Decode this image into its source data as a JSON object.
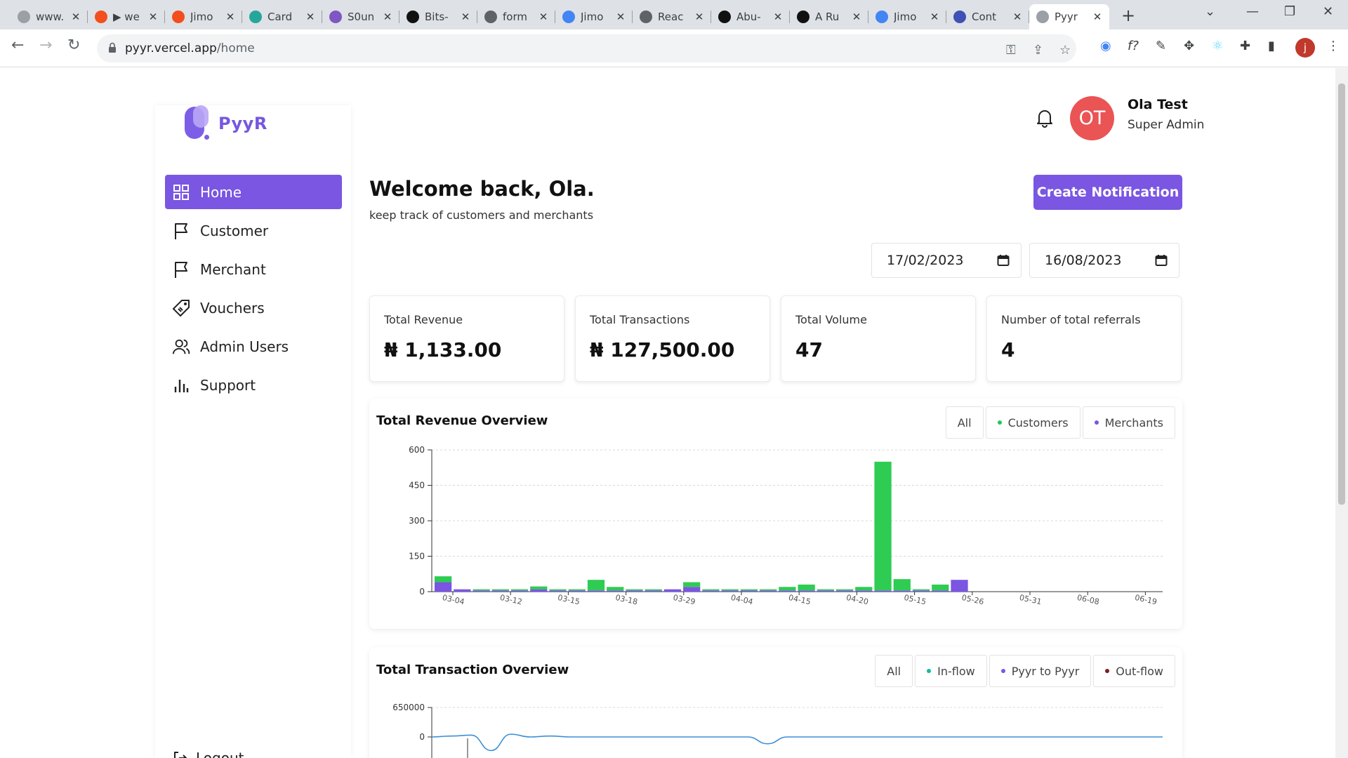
{
  "browser": {
    "tabs": [
      {
        "title": "www.",
        "color": "#9aa0a6"
      },
      {
        "title": "▶ we",
        "color": "#f24e1e"
      },
      {
        "title": "Jimo",
        "color": "#f24e1e"
      },
      {
        "title": "Card",
        "color": "#26a69a"
      },
      {
        "title": "S0un",
        "color": "#7e57c2"
      },
      {
        "title": "Bits-",
        "color": "#111111"
      },
      {
        "title": "form",
        "color": "#5f6368"
      },
      {
        "title": "Jimo",
        "color": "#4285f4"
      },
      {
        "title": "Reac",
        "color": "#5f6368"
      },
      {
        "title": "Abu-",
        "color": "#111111"
      },
      {
        "title": "A Ru",
        "color": "#111111"
      },
      {
        "title": "Jimo",
        "color": "#4285f4"
      },
      {
        "title": "Cont",
        "color": "#3f51b5"
      },
      {
        "title": "Pyyr",
        "color": "#9aa0a6"
      }
    ],
    "url_host": "pyyr.vercel.app",
    "url_path": "/home",
    "profile_initial": "j"
  },
  "brand": {
    "name": "PyyR",
    "accent": "#7a56e2"
  },
  "sidebar": {
    "items": [
      {
        "label": "Home",
        "icon": "grid-icon"
      },
      {
        "label": "Customer",
        "icon": "flag-icon"
      },
      {
        "label": "Merchant",
        "icon": "flag-icon"
      },
      {
        "label": "Vouchers",
        "icon": "tag-icon"
      },
      {
        "label": "Admin Users",
        "icon": "users-icon"
      },
      {
        "label": "Support",
        "icon": "bar-chart-icon"
      }
    ],
    "logout": "Logout"
  },
  "header": {
    "avatar_initials": "OT",
    "user_name": "Ola Test",
    "user_role": "Super Admin"
  },
  "main": {
    "welcome": "Welcome back, Ola.",
    "subtitle": "keep track of customers and merchants",
    "create_button": "Create Notification",
    "date_from": "17/02/2023",
    "date_to": "16/08/2023"
  },
  "stats": [
    {
      "label": "Total Revenue",
      "value": "₦ 1,133.00"
    },
    {
      "label": "Total Transactions",
      "value": "₦ 127,500.00"
    },
    {
      "label": "Total Volume",
      "value": "47"
    },
    {
      "label": "Number of total referrals",
      "value": "4"
    }
  ],
  "revenue_panel": {
    "title": "Total Revenue Overview",
    "filters": [
      {
        "label": "All",
        "dot": ""
      },
      {
        "label": "Customers",
        "dot": "#22c55e"
      },
      {
        "label": "Merchants",
        "dot": "#7a56e2"
      }
    ]
  },
  "transaction_panel": {
    "title": "Total Transaction Overview",
    "filters": [
      {
        "label": "All",
        "dot": ""
      },
      {
        "label": "In-flow",
        "dot": "#14b8a6"
      },
      {
        "label": "Pyyr to Pyyr",
        "dot": "#7a56e2"
      },
      {
        "label": "Out-flow",
        "dot": "#7f1d1d"
      }
    ]
  },
  "chart_data": [
    {
      "type": "bar",
      "stacked": true,
      "title": "Total Revenue Overview",
      "ylim": [
        0,
        600
      ],
      "yticks": [
        0,
        150,
        300,
        450,
        600
      ],
      "xtick_labels": [
        "03-04",
        "03-12",
        "03-15",
        "03-18",
        "03-29",
        "04-04",
        "04-15",
        "04-20",
        "05-15",
        "05-26",
        "05-31",
        "06-08",
        "06-19"
      ],
      "grid": true,
      "series": [
        {
          "color": "#7a56e2",
          "values": [
            40,
            10,
            5,
            5,
            5,
            10,
            5,
            5,
            5,
            5,
            5,
            5,
            10,
            20,
            5,
            5,
            5,
            5,
            5,
            5,
            5,
            5,
            5,
            5,
            5,
            5,
            5,
            50,
            0,
            0,
            0,
            0,
            0,
            0,
            0,
            0,
            0,
            0
          ]
        },
        {
          "color": "#2ecc52",
          "values": [
            25,
            0,
            5,
            5,
            5,
            12,
            5,
            5,
            45,
            15,
            5,
            5,
            0,
            20,
            5,
            5,
            5,
            5,
            15,
            25,
            5,
            5,
            15,
            545,
            48,
            5,
            25,
            0,
            0,
            0,
            0,
            0,
            0,
            0,
            0,
            0,
            0,
            0
          ]
        }
      ]
    },
    {
      "type": "line",
      "title": "Total Transaction Overview",
      "yticks": [
        0,
        650000
      ],
      "grid": true,
      "series": [
        {
          "color": "#3b8fd6",
          "values": [
            0,
            20000,
            40000,
            -300000,
            60000,
            0,
            20000,
            0,
            0,
            0,
            0,
            0,
            0,
            0,
            0,
            0,
            0,
            -150000,
            0,
            0,
            0,
            0,
            0,
            0,
            0,
            0,
            0,
            0,
            0,
            0,
            0,
            0,
            0,
            0,
            0,
            0,
            0,
            0
          ]
        }
      ]
    }
  ]
}
